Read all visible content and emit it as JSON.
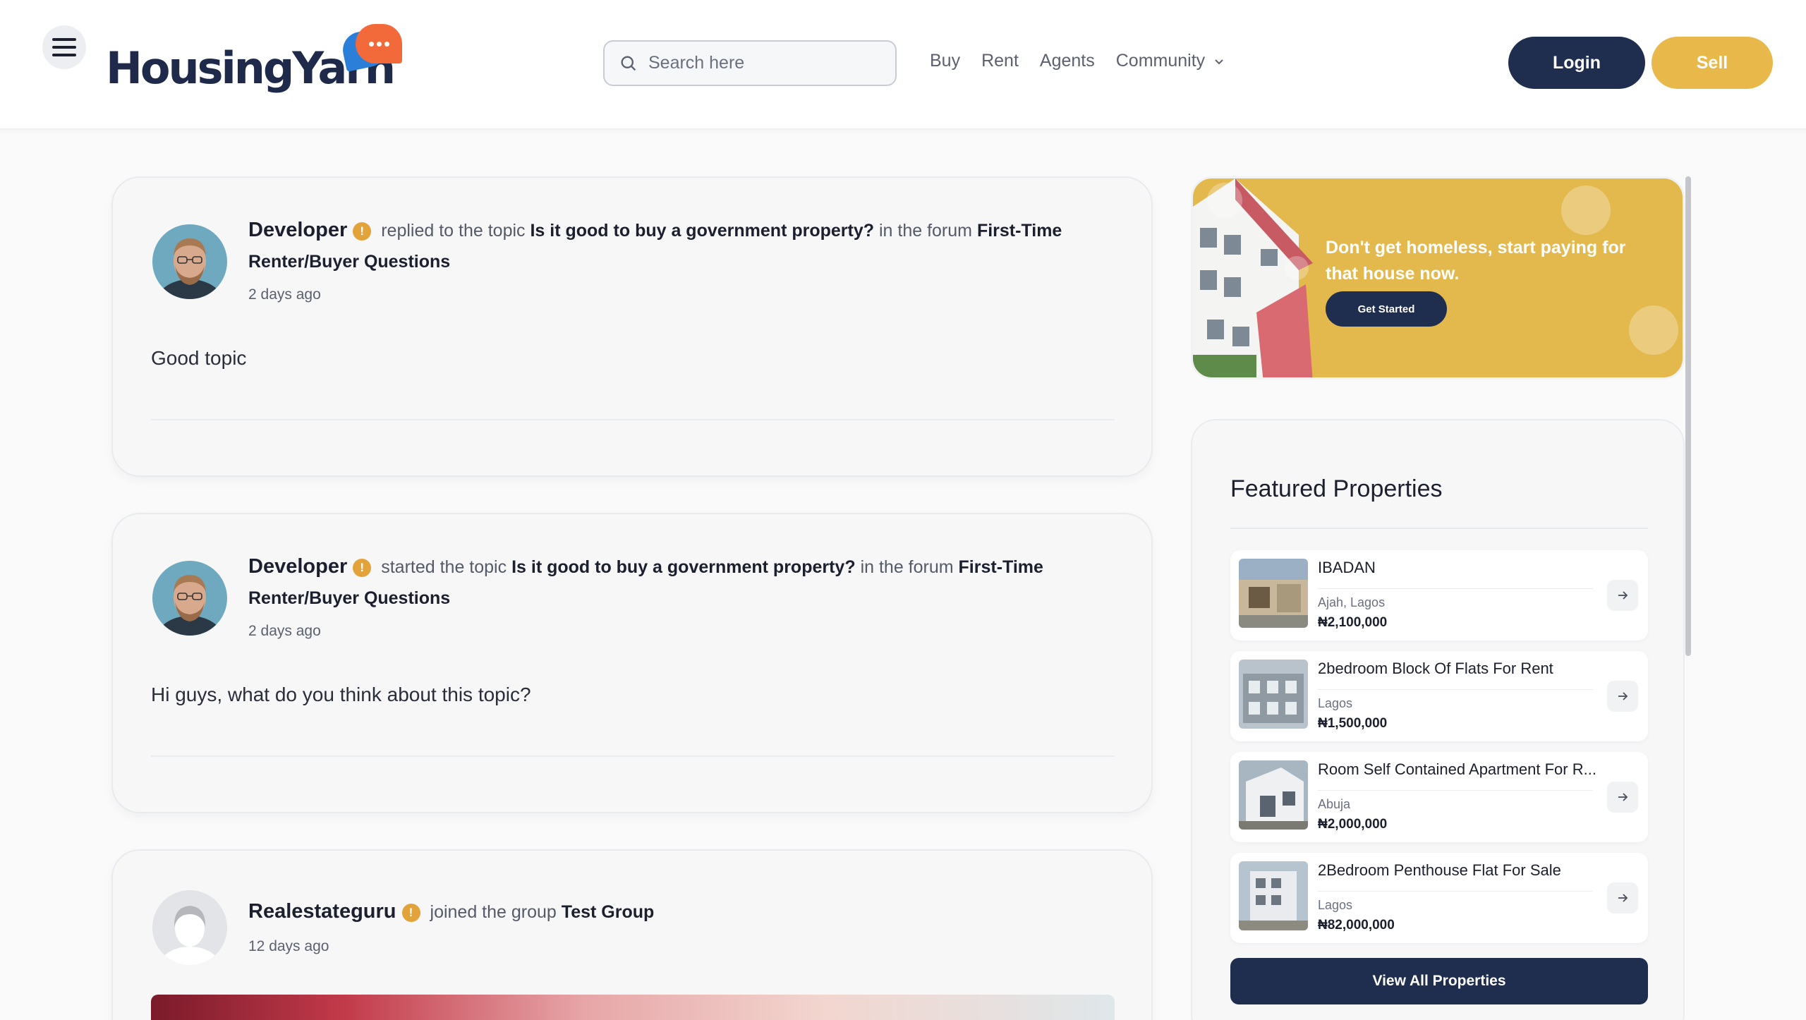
{
  "header": {
    "logo_text": "HousingYarn",
    "search_placeholder": "Search here",
    "nav": {
      "buy": "Buy",
      "rent": "Rent",
      "agents": "Agents",
      "community": "Community"
    },
    "login_label": "Login",
    "sell_label": "Sell"
  },
  "feed": [
    {
      "user": "Developer",
      "badge": "!",
      "action": "replied to the topic",
      "topic": "Is it good to buy a government property?",
      "in_forum": "in the forum",
      "forum": "First-Time Renter/Buyer Questions",
      "time": "2 days ago",
      "body": "Good topic"
    },
    {
      "user": "Developer",
      "badge": "!",
      "action": "started the topic",
      "topic": "Is it good to buy a government property?",
      "in_forum": "in the forum",
      "forum": "First-Time Renter/Buyer Questions",
      "time": "2 days ago",
      "body": "Hi guys, what do you think about this topic?"
    },
    {
      "user": "Realestateguru",
      "badge": "!",
      "action": "joined the group",
      "group": "Test Group",
      "time": "12 days ago"
    }
  ],
  "promo": {
    "title": "Don't get homeless, start paying for that house now.",
    "button": "Get Started"
  },
  "featured": {
    "title": "Featured Properties",
    "items": [
      {
        "name": "IBADAN",
        "location": "Ajah, Lagos",
        "price": "₦2,100,000"
      },
      {
        "name": "2bedroom Block Of Flats For Rent",
        "location": "Lagos",
        "price": "₦1,500,000"
      },
      {
        "name": "Room Self Contained Apartment For R...",
        "location": "Abuja",
        "price": "₦2,000,000"
      },
      {
        "name": "2Bedroom Penthouse Flat For Sale",
        "location": "Lagos",
        "price": "₦82,000,000"
      }
    ],
    "view_all": "View All Properties"
  },
  "colors": {
    "navy": "#1f2d4e",
    "gold": "#e8b84a",
    "badge": "#e2a33a",
    "logo_blue": "#2b7fd8",
    "logo_orange": "#f26a3a"
  }
}
